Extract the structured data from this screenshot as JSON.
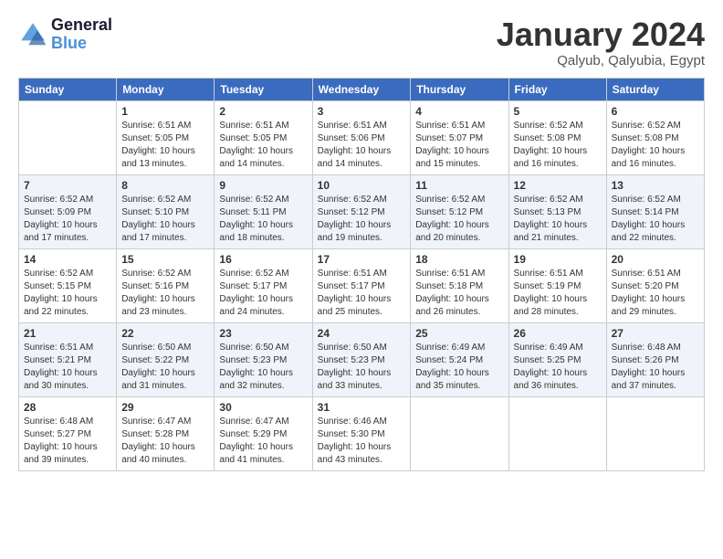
{
  "header": {
    "logo_line1": "General",
    "logo_line2": "Blue",
    "month": "January 2024",
    "location": "Qalyub, Qalyubia, Egypt"
  },
  "weekdays": [
    "Sunday",
    "Monday",
    "Tuesday",
    "Wednesday",
    "Thursday",
    "Friday",
    "Saturday"
  ],
  "weeks": [
    [
      {
        "day": "",
        "sunrise": "",
        "sunset": "",
        "daylight": ""
      },
      {
        "day": "1",
        "sunrise": "Sunrise: 6:51 AM",
        "sunset": "Sunset: 5:05 PM",
        "daylight": "Daylight: 10 hours and 13 minutes."
      },
      {
        "day": "2",
        "sunrise": "Sunrise: 6:51 AM",
        "sunset": "Sunset: 5:05 PM",
        "daylight": "Daylight: 10 hours and 14 minutes."
      },
      {
        "day": "3",
        "sunrise": "Sunrise: 6:51 AM",
        "sunset": "Sunset: 5:06 PM",
        "daylight": "Daylight: 10 hours and 14 minutes."
      },
      {
        "day": "4",
        "sunrise": "Sunrise: 6:51 AM",
        "sunset": "Sunset: 5:07 PM",
        "daylight": "Daylight: 10 hours and 15 minutes."
      },
      {
        "day": "5",
        "sunrise": "Sunrise: 6:52 AM",
        "sunset": "Sunset: 5:08 PM",
        "daylight": "Daylight: 10 hours and 16 minutes."
      },
      {
        "day": "6",
        "sunrise": "Sunrise: 6:52 AM",
        "sunset": "Sunset: 5:08 PM",
        "daylight": "Daylight: 10 hours and 16 minutes."
      }
    ],
    [
      {
        "day": "7",
        "sunrise": "Sunrise: 6:52 AM",
        "sunset": "Sunset: 5:09 PM",
        "daylight": "Daylight: 10 hours and 17 minutes."
      },
      {
        "day": "8",
        "sunrise": "Sunrise: 6:52 AM",
        "sunset": "Sunset: 5:10 PM",
        "daylight": "Daylight: 10 hours and 17 minutes."
      },
      {
        "day": "9",
        "sunrise": "Sunrise: 6:52 AM",
        "sunset": "Sunset: 5:11 PM",
        "daylight": "Daylight: 10 hours and 18 minutes."
      },
      {
        "day": "10",
        "sunrise": "Sunrise: 6:52 AM",
        "sunset": "Sunset: 5:12 PM",
        "daylight": "Daylight: 10 hours and 19 minutes."
      },
      {
        "day": "11",
        "sunrise": "Sunrise: 6:52 AM",
        "sunset": "Sunset: 5:12 PM",
        "daylight": "Daylight: 10 hours and 20 minutes."
      },
      {
        "day": "12",
        "sunrise": "Sunrise: 6:52 AM",
        "sunset": "Sunset: 5:13 PM",
        "daylight": "Daylight: 10 hours and 21 minutes."
      },
      {
        "day": "13",
        "sunrise": "Sunrise: 6:52 AM",
        "sunset": "Sunset: 5:14 PM",
        "daylight": "Daylight: 10 hours and 22 minutes."
      }
    ],
    [
      {
        "day": "14",
        "sunrise": "Sunrise: 6:52 AM",
        "sunset": "Sunset: 5:15 PM",
        "daylight": "Daylight: 10 hours and 22 minutes."
      },
      {
        "day": "15",
        "sunrise": "Sunrise: 6:52 AM",
        "sunset": "Sunset: 5:16 PM",
        "daylight": "Daylight: 10 hours and 23 minutes."
      },
      {
        "day": "16",
        "sunrise": "Sunrise: 6:52 AM",
        "sunset": "Sunset: 5:17 PM",
        "daylight": "Daylight: 10 hours and 24 minutes."
      },
      {
        "day": "17",
        "sunrise": "Sunrise: 6:51 AM",
        "sunset": "Sunset: 5:17 PM",
        "daylight": "Daylight: 10 hours and 25 minutes."
      },
      {
        "day": "18",
        "sunrise": "Sunrise: 6:51 AM",
        "sunset": "Sunset: 5:18 PM",
        "daylight": "Daylight: 10 hours and 26 minutes."
      },
      {
        "day": "19",
        "sunrise": "Sunrise: 6:51 AM",
        "sunset": "Sunset: 5:19 PM",
        "daylight": "Daylight: 10 hours and 28 minutes."
      },
      {
        "day": "20",
        "sunrise": "Sunrise: 6:51 AM",
        "sunset": "Sunset: 5:20 PM",
        "daylight": "Daylight: 10 hours and 29 minutes."
      }
    ],
    [
      {
        "day": "21",
        "sunrise": "Sunrise: 6:51 AM",
        "sunset": "Sunset: 5:21 PM",
        "daylight": "Daylight: 10 hours and 30 minutes."
      },
      {
        "day": "22",
        "sunrise": "Sunrise: 6:50 AM",
        "sunset": "Sunset: 5:22 PM",
        "daylight": "Daylight: 10 hours and 31 minutes."
      },
      {
        "day": "23",
        "sunrise": "Sunrise: 6:50 AM",
        "sunset": "Sunset: 5:23 PM",
        "daylight": "Daylight: 10 hours and 32 minutes."
      },
      {
        "day": "24",
        "sunrise": "Sunrise: 6:50 AM",
        "sunset": "Sunset: 5:23 PM",
        "daylight": "Daylight: 10 hours and 33 minutes."
      },
      {
        "day": "25",
        "sunrise": "Sunrise: 6:49 AM",
        "sunset": "Sunset: 5:24 PM",
        "daylight": "Daylight: 10 hours and 35 minutes."
      },
      {
        "day": "26",
        "sunrise": "Sunrise: 6:49 AM",
        "sunset": "Sunset: 5:25 PM",
        "daylight": "Daylight: 10 hours and 36 minutes."
      },
      {
        "day": "27",
        "sunrise": "Sunrise: 6:48 AM",
        "sunset": "Sunset: 5:26 PM",
        "daylight": "Daylight: 10 hours and 37 minutes."
      }
    ],
    [
      {
        "day": "28",
        "sunrise": "Sunrise: 6:48 AM",
        "sunset": "Sunset: 5:27 PM",
        "daylight": "Daylight: 10 hours and 39 minutes."
      },
      {
        "day": "29",
        "sunrise": "Sunrise: 6:47 AM",
        "sunset": "Sunset: 5:28 PM",
        "daylight": "Daylight: 10 hours and 40 minutes."
      },
      {
        "day": "30",
        "sunrise": "Sunrise: 6:47 AM",
        "sunset": "Sunset: 5:29 PM",
        "daylight": "Daylight: 10 hours and 41 minutes."
      },
      {
        "day": "31",
        "sunrise": "Sunrise: 6:46 AM",
        "sunset": "Sunset: 5:30 PM",
        "daylight": "Daylight: 10 hours and 43 minutes."
      },
      {
        "day": "",
        "sunrise": "",
        "sunset": "",
        "daylight": ""
      },
      {
        "day": "",
        "sunrise": "",
        "sunset": "",
        "daylight": ""
      },
      {
        "day": "",
        "sunrise": "",
        "sunset": "",
        "daylight": ""
      }
    ]
  ]
}
